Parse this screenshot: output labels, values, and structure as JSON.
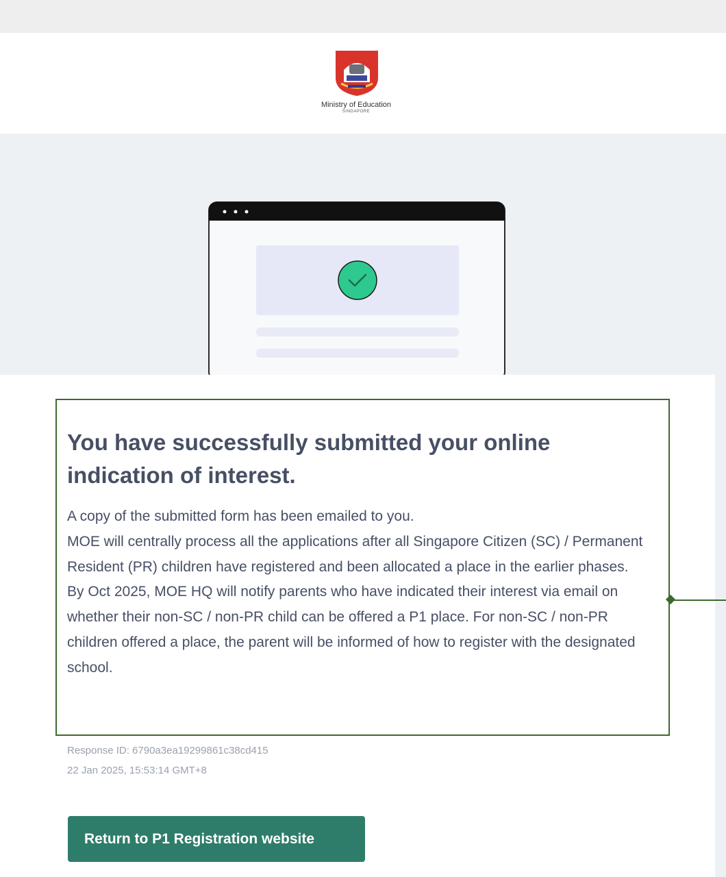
{
  "header": {
    "org_name": "Ministry of Education",
    "org_country": "SINGAPORE"
  },
  "confirmation": {
    "title": "You have successfully submitted your online indication of interest.",
    "paragraphs": [
      "A copy of the submitted form has been emailed to you.",
      "MOE will centrally process all the applications after all Singapore Citizen (SC) / Permanent Resident (PR) children have registered and been allocated a place in the earlier phases.",
      "By Oct 2025, MOE HQ will notify parents who have indicated their interest via email on whether their non-SC / non-PR child can be offered a P1 place. For non-SC / non-PR children offered a place, the parent will be informed of how to register with the designated school."
    ],
    "response_id": "Response ID: 6790a3ea19299861c38cd415",
    "timestamp": "22 Jan 2025, 15:53:14 GMT+8"
  },
  "actions": {
    "return_label": "Return to P1 Registration website"
  },
  "colors": {
    "accent": "#2e7d6a",
    "success_check": "#2ec98f",
    "highlight_border": "#3c6a2e"
  }
}
